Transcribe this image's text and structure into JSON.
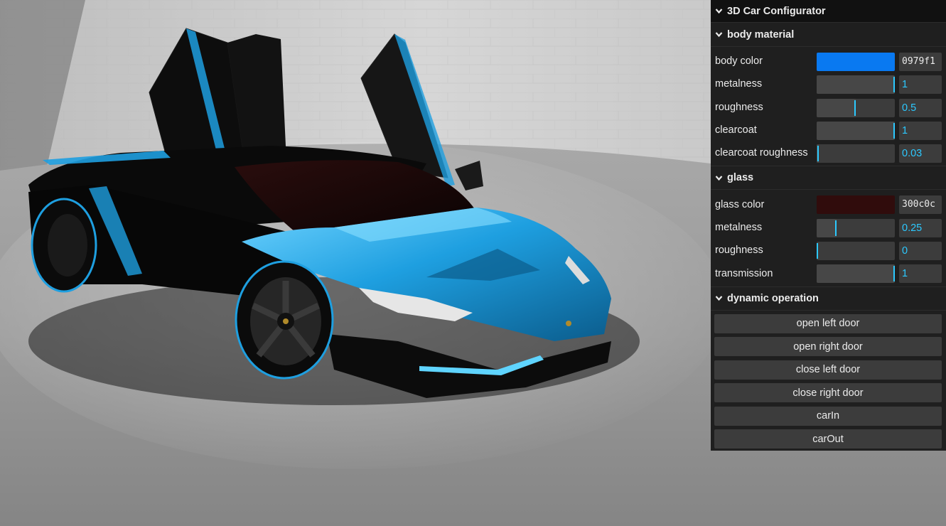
{
  "gui": {
    "title": "3D Car Configurator",
    "folders": {
      "body": {
        "title": "body material",
        "color": {
          "label": "body color",
          "value": "0979f1",
          "hex": "#0979f1"
        },
        "metalness": {
          "label": "metalness",
          "value": "1",
          "level": 1.0
        },
        "roughness": {
          "label": "roughness",
          "value": "0.5",
          "level": 0.5
        },
        "clearcoat": {
          "label": "clearcoat",
          "value": "1",
          "level": 1.0
        },
        "clearcoat_roughness": {
          "label": "clearcoat roughness",
          "value": "0.03",
          "level": 0.03
        }
      },
      "glass": {
        "title": "glass",
        "color": {
          "label": "glass color",
          "value": "300c0c",
          "hex": "#300c0c"
        },
        "metalness": {
          "label": "metalness",
          "value": "0.25",
          "level": 0.25
        },
        "roughness": {
          "label": "roughness",
          "value": "0",
          "level": 0.0
        },
        "transmission": {
          "label": "transmission",
          "value": "1",
          "level": 1.0
        }
      },
      "dynamic": {
        "title": "dynamic operation",
        "buttons": [
          "open left door",
          "open right door",
          "close left door",
          "close right door",
          "carIn",
          "carOut"
        ]
      }
    }
  },
  "colors": {
    "accent": "#2cc9ff",
    "panel_bg": "#1f1f1f",
    "car_paint": "#1e9fe0"
  },
  "icons": {
    "folder_toggle": "chevron-down-icon"
  }
}
